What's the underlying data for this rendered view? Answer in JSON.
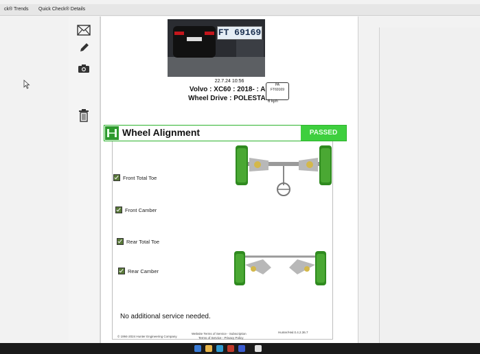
{
  "topbar": {
    "tab1": "ck® Trends",
    "tab2": "Quick Check® Details"
  },
  "sidebar": {
    "icons": [
      "mail-icon",
      "pencil-icon",
      "camera-icon",
      "trash-icon"
    ]
  },
  "vehicle": {
    "plate": "FT 69169",
    "timestamp": "22.7.24 10:56",
    "model": "Volvo : XC60 : 2018- : All",
    "drive": "Wheel Drive : POLESTAR",
    "badge_line1": "PA",
    "badge_line2": "FT69169",
    "speed": "6 kph"
  },
  "section": {
    "title": "Wheel Alignment",
    "status": "PASSED"
  },
  "checks": [
    "Front Total Toe",
    "Front Camber",
    "Rear Total Toe",
    "Rear Camber"
  ],
  "service_message": "No additional service needed.",
  "footer": {
    "copyright": "© 1994-2024 Hunter Engineering Company",
    "links1": "Website Terms of Service - Subscription",
    "links2": "Terms of Service - Privacy Policy",
    "version": "Hunter/Hwl.0.4.2.36.7"
  },
  "colors": {
    "pass": "#3ecf3e",
    "tire": "#2f8a1f",
    "accent": "#2db32d"
  }
}
